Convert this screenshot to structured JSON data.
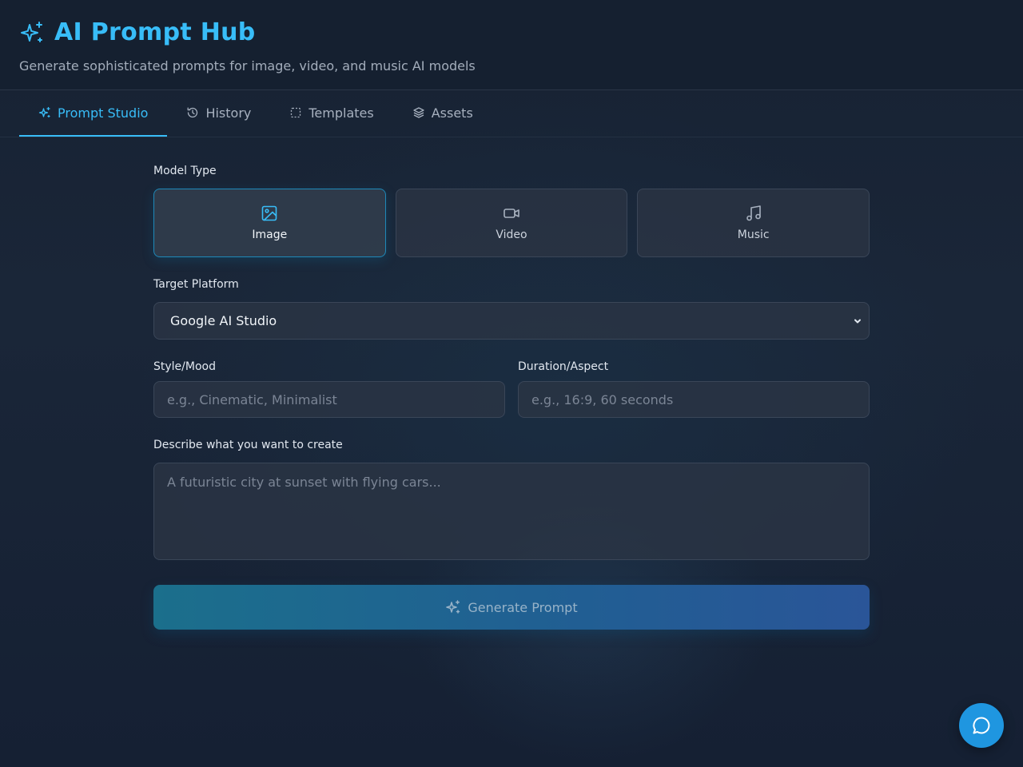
{
  "header": {
    "title": "AI Prompt Hub",
    "subtitle": "Generate sophisticated prompts for image, video, and music AI models",
    "icon": "sparkles-icon"
  },
  "tabs": [
    {
      "label": "Prompt Studio",
      "icon": "sparkles-icon",
      "active": true
    },
    {
      "label": "History",
      "icon": "history-icon",
      "active": false
    },
    {
      "label": "Templates",
      "icon": "dashed-square-icon",
      "active": false
    },
    {
      "label": "Assets",
      "icon": "layers-icon",
      "active": false
    }
  ],
  "form": {
    "model_type_label": "Model Type",
    "model_types": [
      {
        "label": "Image",
        "icon": "image-icon",
        "selected": true
      },
      {
        "label": "Video",
        "icon": "video-icon",
        "selected": false
      },
      {
        "label": "Music",
        "icon": "music-icon",
        "selected": false
      }
    ],
    "platform_label": "Target Platform",
    "platform_value": "Google AI Studio",
    "style_label": "Style/Mood",
    "style_placeholder": "e.g., Cinematic, Minimalist",
    "duration_label": "Duration/Aspect",
    "duration_placeholder": "e.g., 16:9, 60 seconds",
    "describe_label": "Describe what you want to create",
    "describe_placeholder": "A futuristic city at sunset with flying cars...",
    "generate_label": "Generate Prompt"
  },
  "colors": {
    "accent": "#38bdf8",
    "chat_button": "#1f96e0",
    "background": "#172233"
  },
  "chat": {
    "icon": "chat-bubble-icon"
  }
}
